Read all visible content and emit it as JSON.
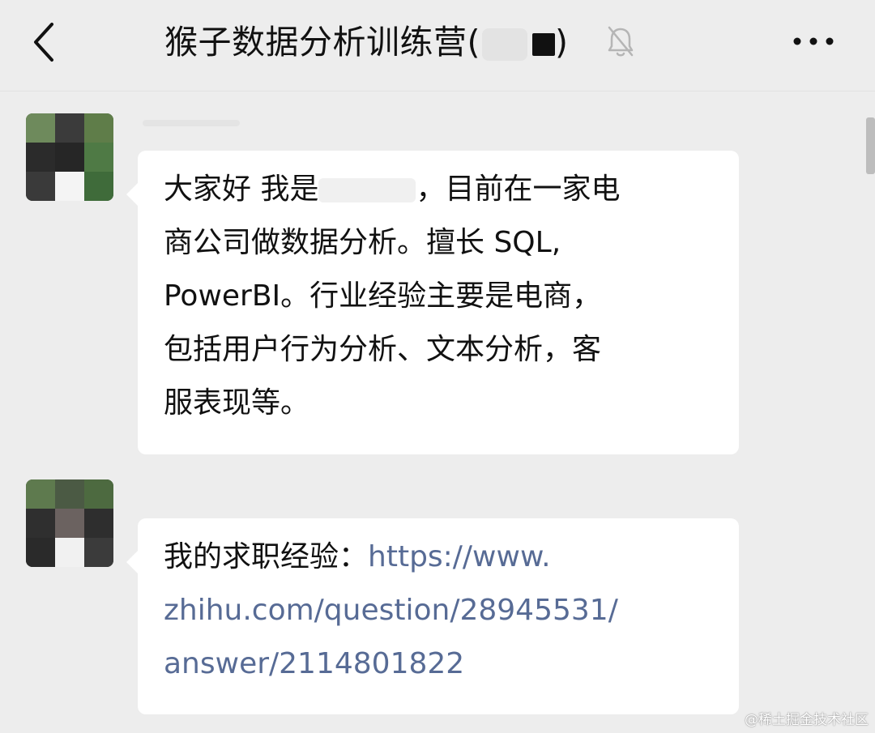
{
  "header": {
    "title": "猴子数据分析训练营(",
    "title_close": ")",
    "back_icon": "chevron-left-icon",
    "mute_icon": "bell-off-icon",
    "more_icon": "more-dots-icon"
  },
  "messages": [
    {
      "lines": [
        "大家好 我是",
        "，目前在一家电",
        "商公司做数据分析。擅长 SQL,",
        "PowerBI。行业经验主要是电商，",
        "包括用户行为分析、文本分析，客",
        "服表现等。"
      ]
    },
    {
      "prefix": "我的求职经验：",
      "link_parts": [
        "https://www.",
        "zhihu.com/question/28945531/",
        "answer/2114801822"
      ]
    }
  ],
  "watermark": "@稀土掘金技术社区",
  "colors": {
    "background": "#ededed",
    "bubble": "#ffffff",
    "link": "#576b95"
  }
}
